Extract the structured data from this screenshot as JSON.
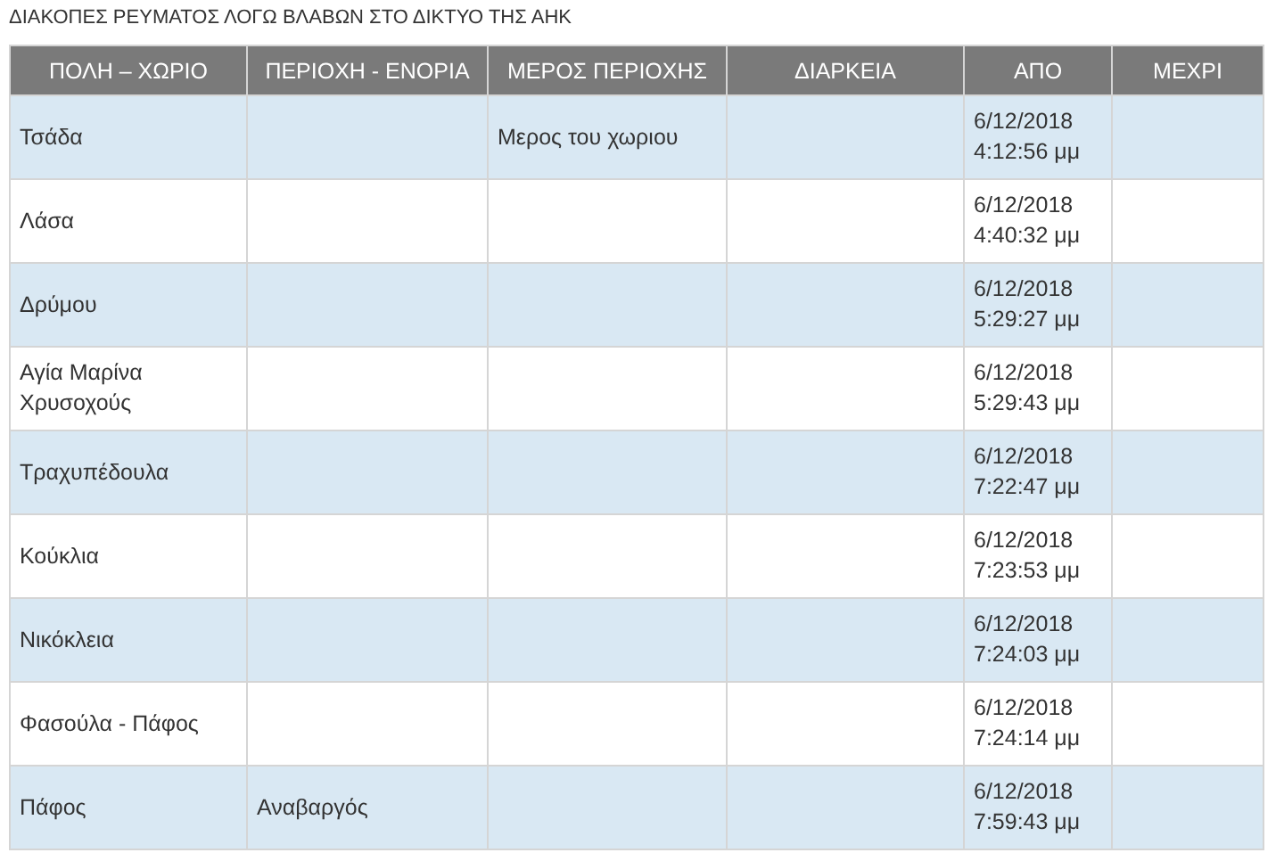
{
  "title": "ΔΙΑΚΟΠΕΣ ΡΕΥΜΑΤΟΣ ΛΟΓΩ ΒΛΑΒΩΝ ΣΤΟ ΔΙΚΤΥΟ ΤΗΣ ΑΗΚ",
  "table": {
    "columns": [
      "ΠΟΛΗ – ΧΩΡΙΟ",
      "ΠΕΡΙΟΧΗ - ΕΝΟΡΙΑ",
      "ΜΕΡΟΣ ΠΕΡΙΟΧΗΣ",
      "ΔΙΑΡΚΕΙΑ",
      "ΑΠΟ",
      "ΜΕΧΡΙ"
    ],
    "rows": [
      {
        "cells": [
          "Τσάδα",
          null,
          "Μερος του χωριου",
          null,
          "6/12/2018\n4:12:56 μμ",
          null
        ]
      },
      {
        "cells": [
          "Λάσα",
          null,
          null,
          null,
          "6/12/2018\n4:40:32 μμ",
          null
        ]
      },
      {
        "cells": [
          "Δρύμου",
          null,
          null,
          null,
          "6/12/2018\n5:29:27 μμ",
          null
        ]
      },
      {
        "cells": [
          "Αγία Μαρίνα\nΧρυσοχούς",
          null,
          null,
          null,
          "6/12/2018\n5:29:43 μμ",
          null
        ]
      },
      {
        "cells": [
          "Τραχυπέδουλα",
          null,
          null,
          null,
          "6/12/2018\n7:22:47 μμ",
          null
        ]
      },
      {
        "cells": [
          "Κούκλια",
          null,
          null,
          null,
          "6/12/2018\n7:23:53 μμ",
          null
        ]
      },
      {
        "cells": [
          "Νικόκλεια",
          null,
          null,
          null,
          "6/12/2018\n7:24:03 μμ",
          null
        ]
      },
      {
        "cells": [
          "Φασούλα - Πάφος",
          null,
          null,
          null,
          "6/12/2018\n7:24:14 μμ",
          null
        ]
      },
      {
        "cells": [
          "Πάφος",
          "Αναβαργός",
          null,
          null,
          "6/12/2018\n7:59:43 μμ",
          null
        ]
      }
    ]
  }
}
